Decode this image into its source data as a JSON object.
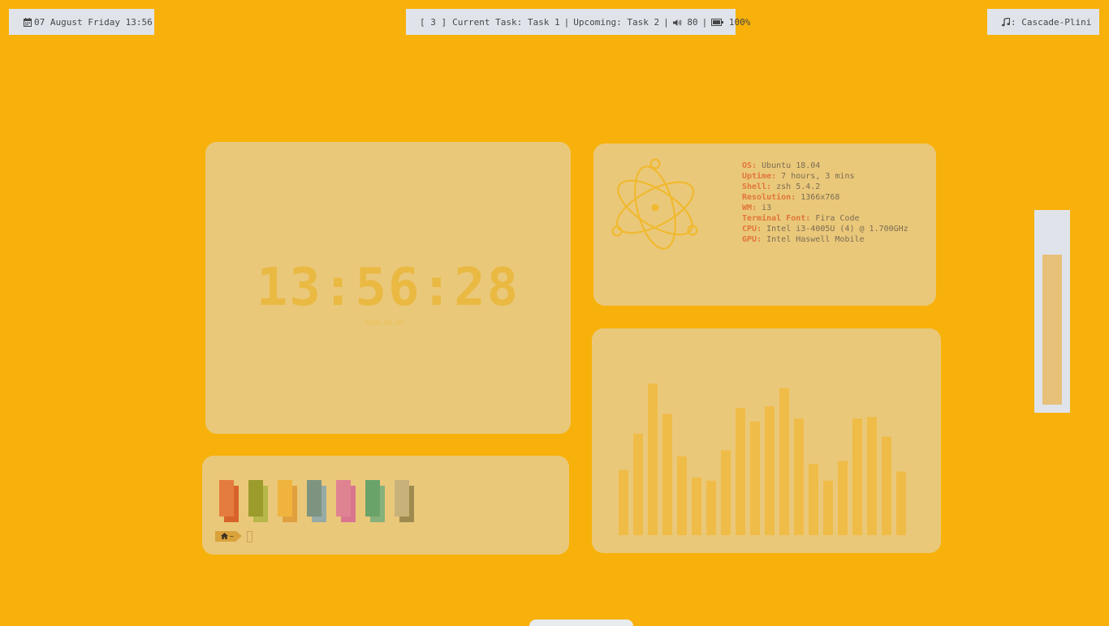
{
  "topbar": {
    "left": {
      "icon": "calendar-icon",
      "text": "07 August Friday 13:56"
    },
    "center": {
      "workspace": "[ 3 ]",
      "current_task": "Current Task: Task 1",
      "upcoming_task": "Upcoming: Task 2",
      "separator": "|",
      "volume_icon": "speaker-icon",
      "volume": "80",
      "battery_icon": "battery-icon",
      "battery": "100%"
    },
    "right": {
      "icon": "music-note-icon",
      "text": ": Cascade-Plini"
    }
  },
  "clock_widget": {
    "time": "13:56:28",
    "date": "2020-08-07"
  },
  "sysinfo": {
    "logo_icon": "electron-atom-icon",
    "rows": [
      {
        "key": "OS:",
        "value": "Ubuntu 18.04"
      },
      {
        "key": "Uptime:",
        "value": "7 hours, 3 mins"
      },
      {
        "key": "Shell:",
        "value": "zsh 5.4.2"
      },
      {
        "key": "Resolution:",
        "value": "1366x768"
      },
      {
        "key": "WM:",
        "value": "i3"
      },
      {
        "key": "Terminal Font:",
        "value": "Fira Code"
      },
      {
        "key": "CPU:",
        "value": "Intel i3-4005U (4) @ 1.700GHz"
      },
      {
        "key": "GPU:",
        "value": "Intel Haswell Mobile"
      }
    ]
  },
  "terminal": {
    "palette": [
      {
        "front": "#e57c3f",
        "back": "#d8632a"
      },
      {
        "front": "#9c9c2c",
        "back": "#b7b74a"
      },
      {
        "front": "#f0b43e",
        "back": "#e0a03e"
      },
      {
        "front": "#7e9480",
        "back": "#96aaa6"
      },
      {
        "front": "#df8292",
        "back": "#d9758f"
      },
      {
        "front": "#6aa36a",
        "back": "#86b17a"
      },
      {
        "front": "#c8b27a",
        "back": "#9e8a4e"
      }
    ],
    "prompt": {
      "icon": "home-icon",
      "path": "~"
    }
  },
  "visualizer": {
    "levels": [
      0.43,
      0.67,
      1.0,
      0.8,
      0.52,
      0.38,
      0.36,
      0.56,
      0.84,
      0.75,
      0.85,
      0.97,
      0.77,
      0.47,
      0.36,
      0.49,
      0.77,
      0.78,
      0.65,
      0.42
    ],
    "color": "#f0bc48"
  },
  "volume_slider": {
    "level": 0.74
  },
  "colors": {
    "background": "#f7b10a",
    "panel": "#eac87a",
    "bar": "#e0e4ea",
    "accent": "#e0763a"
  }
}
